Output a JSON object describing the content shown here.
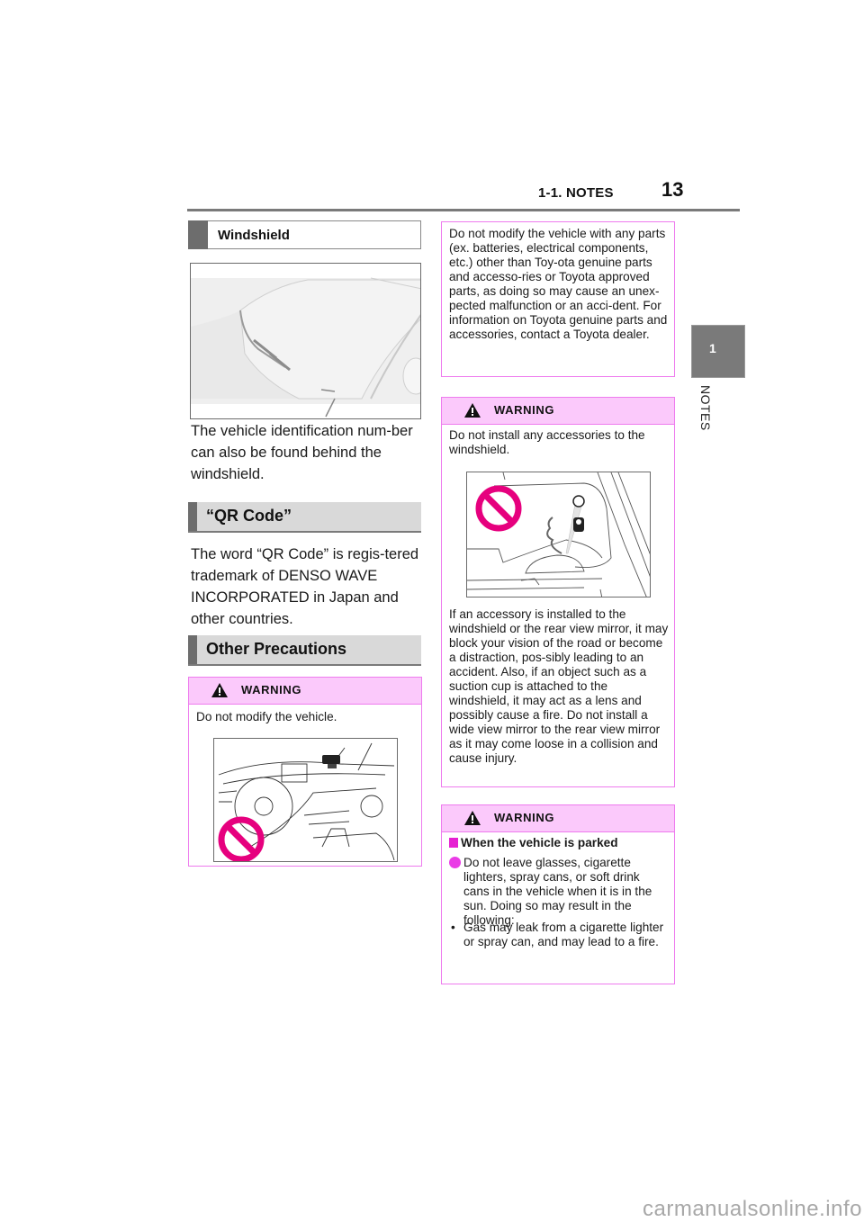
{
  "header": {
    "section": "1-1. NOTES",
    "page_number": "13",
    "side_tab_number": "1",
    "side_tab_label": "NOTES"
  },
  "left_column": {
    "windshield": {
      "heading": "Windshield",
      "figure": "windshield-illustration",
      "text": "The vehicle identification num-ber can also be found behind the windshield."
    },
    "qr_code": {
      "heading": "“QR Code”",
      "text": "The word “QR Code” is regis-tered trademark of DENSO WAVE INCORPORATED in Japan and other countries."
    },
    "other_precautions": {
      "heading": "Other Precautions",
      "warning": {
        "title": "WARNING",
        "text": "Do not modify the vehicle.",
        "figure": "dashboard-modification-prohibited-illustration"
      }
    }
  },
  "right_column": {
    "continued_box": {
      "text": "Do not modify the vehicle with any parts (ex. batteries, electrical components, etc.) other than Toy-ota genuine parts and accesso-ries or Toyota approved parts, as doing so may cause an unex-pected malfunction or an acci-dent. For information on Toyota genuine parts and accessories, contact a Toyota dealer."
    },
    "warning_windshield": {
      "title": "WARNING",
      "intro": "Do not install any accessories to the windshield.",
      "figure": "windshield-accessory-prohibited-illustration",
      "text": "If an accessory is installed to the windshield or the rear view mirror, it may block your vision of the road or become a distraction, pos-sibly leading to an accident. Also, if an object such as a suction cup is attached to the windshield, it may act as a lens and possibly cause a fire. Do not install a wide view mirror to the rear view mirror as it may come loose in a collision and cause injury."
    },
    "warning_parked": {
      "title": "WARNING",
      "subheading": "When the vehicle is parked",
      "bullet": "Do not leave glasses, cigarette lighters, spray cans, or soft drink cans in the vehicle when it is in the sun. Doing so may result in the following:",
      "sub_bullet": "Gas may leak from a cigarette lighter or spray can, and may lead to a fire."
    }
  },
  "watermark": "carmanualsonline.info",
  "colors": {
    "warning_header_bg": "#fbc9fb",
    "warning_border": "#ee7bee",
    "prohibition_magenta": "#e6007e",
    "section_bar_gray": "#6d6d6d",
    "section_bg_gray": "#d9d9d9"
  }
}
